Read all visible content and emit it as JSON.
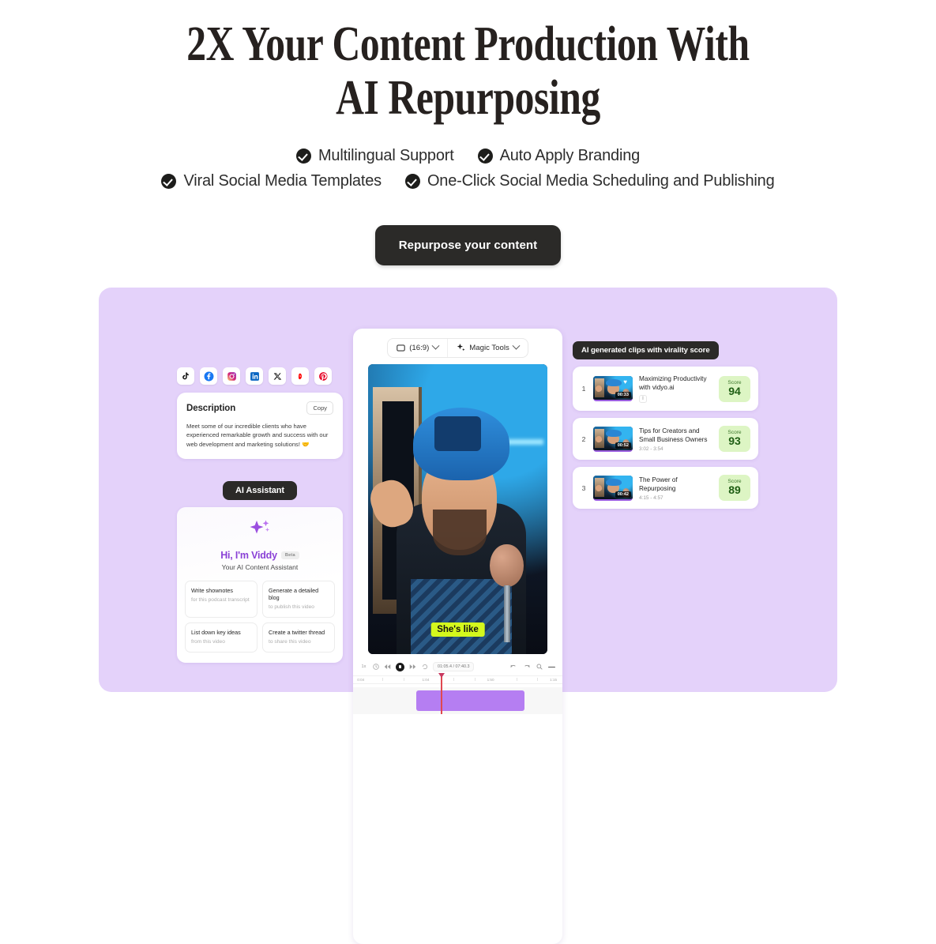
{
  "hero": {
    "headline": "2X Your Content Production With\nAI Repurposing",
    "features_row1": [
      "Multilingual Support",
      "Auto Apply Branding"
    ],
    "features_row2": [
      "Viral Social Media Templates",
      "One-Click Social Media Scheduling and Publishing"
    ],
    "cta_label": "Repurpose your content"
  },
  "colors": {
    "showcase_bg": "#e4d2fa",
    "dark": "#2b2a28",
    "caption_bg": "#d4f81d",
    "score_bg": "#ddf5c4",
    "accent_purple": "#8a41d6"
  },
  "left": {
    "social_icons": [
      "tiktok-icon",
      "facebook-icon",
      "instagram-icon",
      "linkedin-icon",
      "x-icon",
      "youtube-icon",
      "pinterest-icon"
    ],
    "description": {
      "title": "Description",
      "copy_label": "Copy",
      "body": "Meet some of our incredible clients who have experienced remarkable growth and success with our web development and marketing solutions! 🤝"
    },
    "assistant": {
      "pill": "AI Assistant",
      "greeting": "Hi, I'm Viddy",
      "badge": "Beta",
      "subtitle": "Your AI Content Assistant",
      "suggestions": [
        {
          "title": "Write shownotes",
          "sub": "for this podcast transcript"
        },
        {
          "title": "Generate a detailed blog",
          "sub": "to publish this video"
        },
        {
          "title": "List down key ideas",
          "sub": "from this video"
        },
        {
          "title": "Create a twitter thread",
          "sub": "to share this video"
        }
      ]
    }
  },
  "editor": {
    "aspect_ratio": "(16:9)",
    "magic_tools": "Magic Tools",
    "caption": "She's like",
    "timecode": "01:05.4 / 07:40.3",
    "ruler_labels": [
      "0:04",
      "1:04",
      "1:50",
      "1:15"
    ]
  },
  "clips": {
    "pill": "AI generated clips with virality score",
    "score_label": "Score",
    "items": [
      {
        "index": "1",
        "title": "Maximizing Productivity with vidyo.ai",
        "duration": "00:33",
        "range": "",
        "score": "94"
      },
      {
        "index": "2",
        "title": "Tips for Creators and Small Business Owners",
        "duration": "00:52",
        "range": "3:02 - 3:54",
        "score": "93"
      },
      {
        "index": "3",
        "title": "The Power of Repurposing",
        "duration": "00:42",
        "range": "4:15 - 4:57",
        "score": "89"
      }
    ]
  }
}
